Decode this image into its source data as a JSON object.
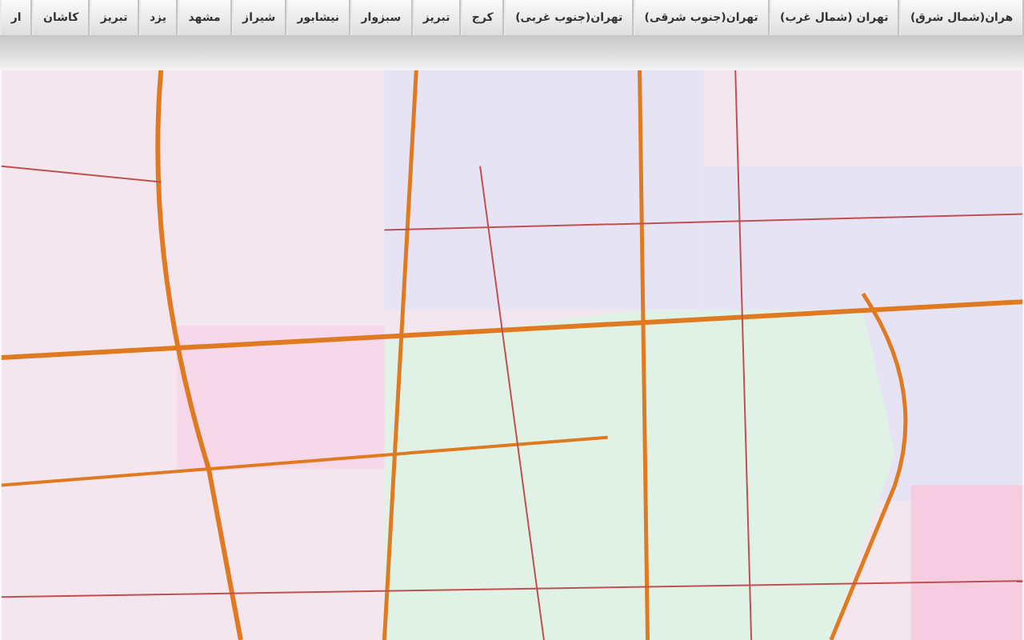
{
  "tabs": [
    {
      "label": "هران(شمال شرق)"
    },
    {
      "label": "تهران (شمال غرب)"
    },
    {
      "label": "تهران(جنوب شرقی)"
    },
    {
      "label": "تهران(جنوب غربی)"
    },
    {
      "label": "کرج"
    },
    {
      "label": "تبریز"
    },
    {
      "label": "سبزوار"
    },
    {
      "label": "نیشابور"
    },
    {
      "label": "شیراز"
    },
    {
      "label": "مشهد"
    },
    {
      "label": "یزد"
    },
    {
      "label": "تبریز"
    },
    {
      "label": "کاشان"
    },
    {
      "label": "ار"
    }
  ]
}
